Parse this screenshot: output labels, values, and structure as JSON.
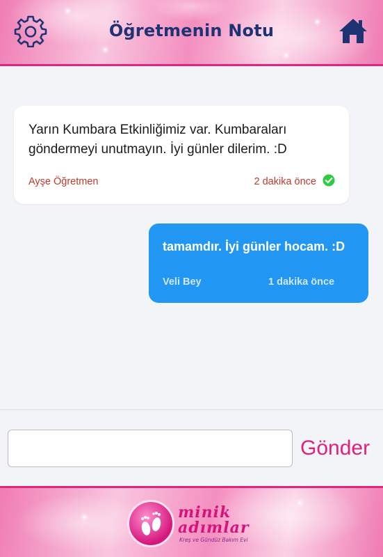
{
  "header": {
    "title": "Öğretmenin Notu",
    "settings_icon": "gear-icon",
    "home_icon": "home-icon"
  },
  "messages": [
    {
      "direction": "incoming",
      "text": "Yarın Kumbara Etkinliğimiz var. Kumbaraları göndermeyi unutmayın. İyi günler dilerim. :D",
      "sender": "Ayşe Öğretmen",
      "time": "2 dakika önce",
      "status_icon": "check-circle-icon"
    },
    {
      "direction": "outgoing",
      "text": "tamamdır. İyi günler hocam. :D",
      "sender": "Veli Bey",
      "time": "1 dakika önce"
    }
  ],
  "composer": {
    "value": "",
    "placeholder": "",
    "send_label": "Gönder"
  },
  "footer": {
    "logo_line1": "minik",
    "logo_line2": "adımlar",
    "logo_tagline": "Kreş ve Gündüz Bakım Evi"
  },
  "colors": {
    "brand_pink": "#e0207d",
    "title_navy": "#1e3373",
    "outgoing_bubble": "#2196f3",
    "incoming_meta": "#c0392b",
    "check_green": "#2ecc40"
  }
}
